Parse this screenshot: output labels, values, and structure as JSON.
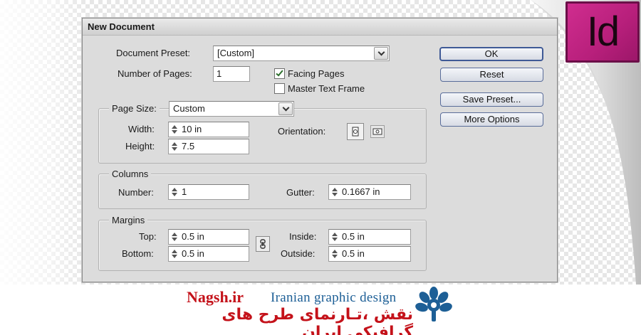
{
  "dialog": {
    "title": "New Document",
    "preset": {
      "label": "Document Preset:",
      "value": "[Custom]"
    },
    "pages": {
      "label": "Number of Pages:",
      "value": "1"
    },
    "facing_pages": {
      "label": "Facing Pages",
      "checked": true
    },
    "master_text_frame": {
      "label": "Master Text Frame",
      "checked": false
    },
    "page_size": {
      "label": "Page Size:",
      "value": "Custom",
      "width_label": "Width:",
      "width_value": "10 in",
      "height_label": "Height:",
      "height_value": "7.5",
      "orientation_label": "Orientation:"
    },
    "columns": {
      "title": "Columns",
      "number_label": "Number:",
      "number_value": "1",
      "gutter_label": "Gutter:",
      "gutter_value": "0.1667 in"
    },
    "margins": {
      "title": "Margins",
      "top_label": "Top:",
      "top_value": "0.5 in",
      "bottom_label": "Bottom:",
      "bottom_value": "0.5 in",
      "inside_label": "Inside:",
      "inside_value": "0.5 in",
      "outside_label": "Outside:",
      "outside_value": "0.5 in"
    },
    "buttons": {
      "ok": "OK",
      "reset": "Reset",
      "save_preset": "Save Preset...",
      "more_options": "More Options"
    }
  },
  "app_logo": {
    "text": "Id",
    "color": "#c4238a"
  },
  "footer": {
    "site": "Nagsh.ir",
    "tagline": "Iranian graphic design",
    "persian": "نقش ،تـارنمای طرح های گرافیکی ایران",
    "brand_red": "#c4121a",
    "brand_blue": "#1d5f96"
  }
}
